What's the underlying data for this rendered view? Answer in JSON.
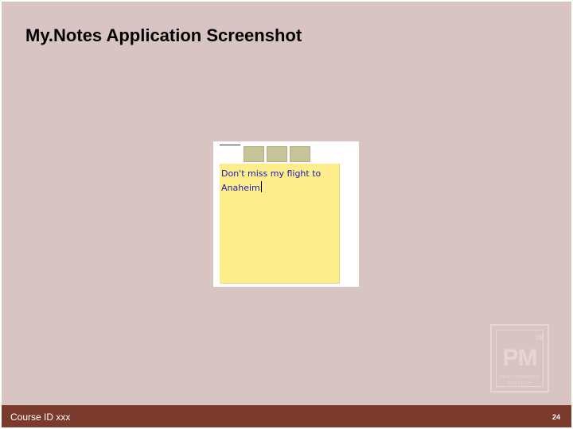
{
  "slide": {
    "title": "My.Notes Application Screenshot",
    "background_color": "#d8c4c3"
  },
  "app_screenshot": {
    "note_text": "Don't miss my flight to Anaheim",
    "note_color": "#fdee8b",
    "text_color": "#1a1ab4",
    "tab_color": "#c7c49a"
  },
  "logo": {
    "mark": "PM",
    "number": "08",
    "line1": "PERFORMANCE",
    "line2": "MATTERS",
    "icon": "pm-logo-icon"
  },
  "footer": {
    "left_text": "Course ID xxx",
    "page_number": "24",
    "bar_color": "#7a3a2c"
  }
}
